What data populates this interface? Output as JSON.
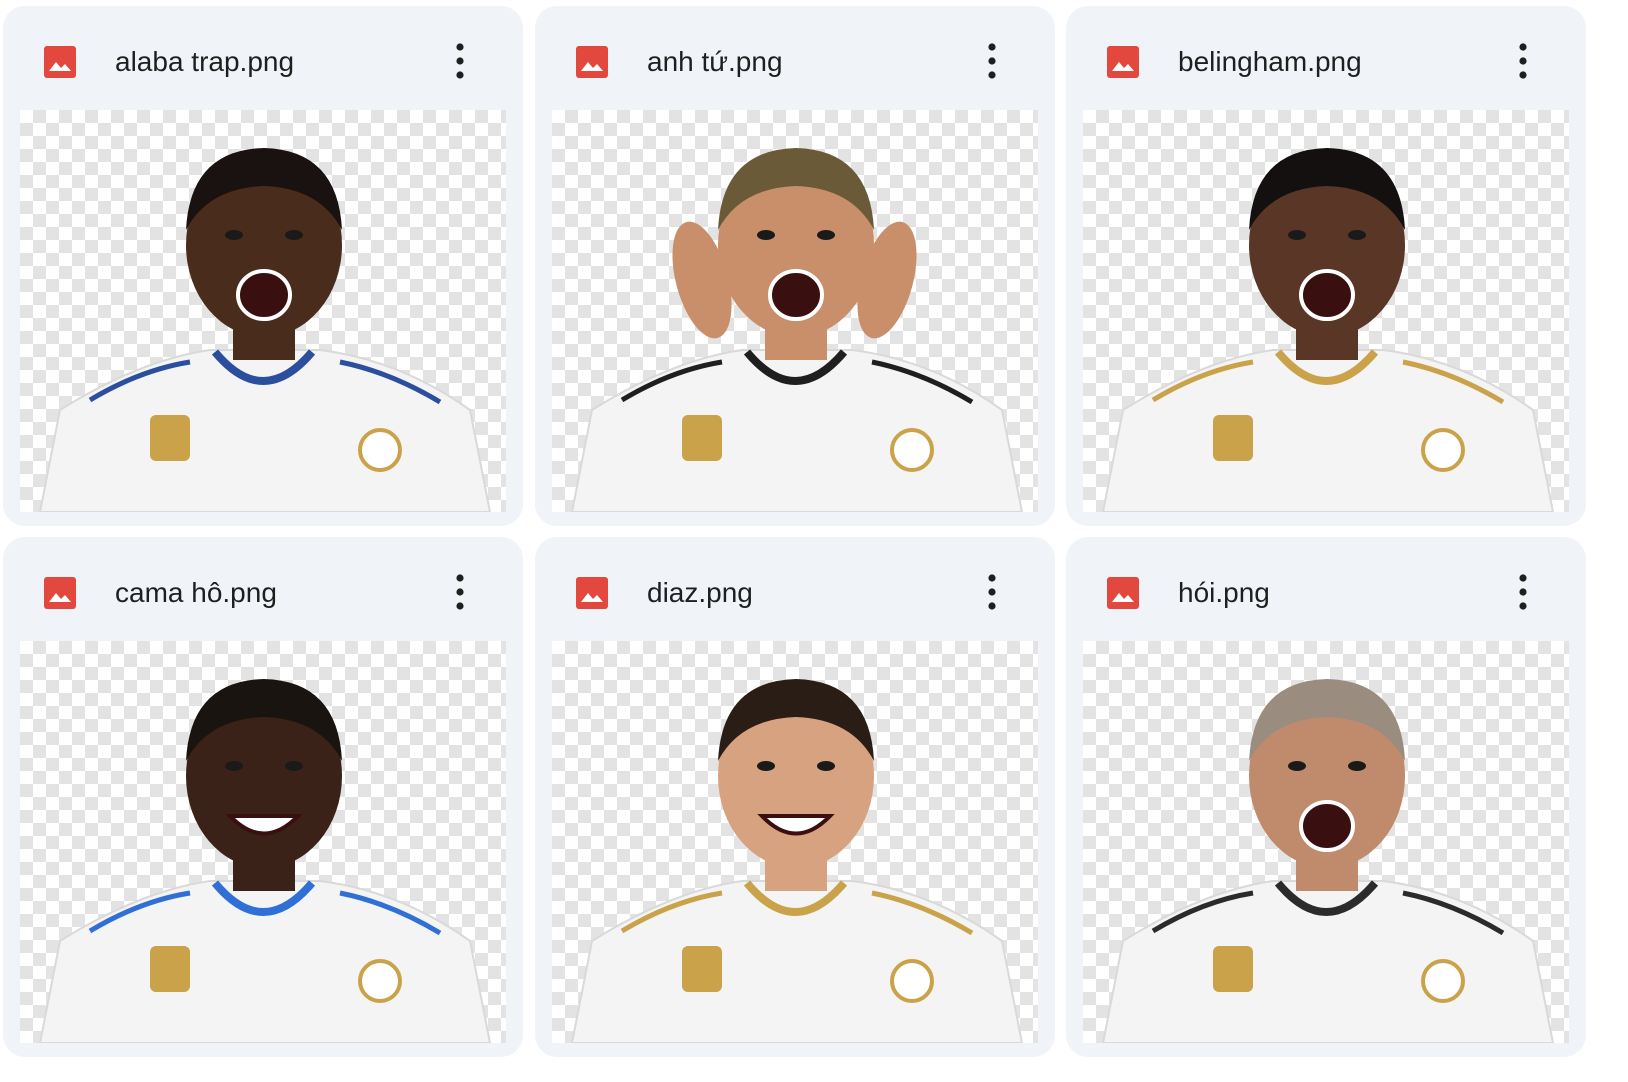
{
  "files": [
    {
      "name": "alaba trap.png",
      "icon": "image-file-icon",
      "thumb": "player-celebrating-image",
      "skin": "#4a2c1d",
      "hair": "#1a1210",
      "mouth": "open",
      "kit_trim": "#2b4f9e",
      "hands_up": false
    },
    {
      "name": "anh tứ.png",
      "icon": "image-file-icon",
      "thumb": "player-cupping-ears-image",
      "skin": "#c98e6a",
      "hair": "#6b5a38",
      "mouth": "open",
      "kit_trim": "#1f1f1f",
      "hands_up": true
    },
    {
      "name": "belingham.png",
      "icon": "image-file-icon",
      "thumb": "player-shouting-image",
      "skin": "#5a3626",
      "hair": "#151010",
      "mouth": "open",
      "kit_trim": "#c9a24a",
      "hands_up": false
    },
    {
      "name": "cama hô.png",
      "icon": "image-file-icon",
      "thumb": "player-laughing-image",
      "skin": "#3b2218",
      "hair": "#1a1410",
      "mouth": "smile",
      "kit_trim": "#2f6fd6",
      "hands_up": false
    },
    {
      "name": "diaz.png",
      "icon": "image-file-icon",
      "thumb": "player-smiling-image",
      "skin": "#d7a27f",
      "hair": "#2a1d16",
      "mouth": "smile",
      "kit_trim": "#c9a24a",
      "hands_up": false
    },
    {
      "name": "hói.png",
      "icon": "image-file-icon",
      "thumb": "player-roaring-image",
      "skin": "#c08a6c",
      "hair": "#9a8c7e",
      "mouth": "open",
      "kit_trim": "#2b2b2b",
      "hands_up": false
    }
  ],
  "colors": {
    "card_bg": "#f0f4f9",
    "icon_red": "#e2483d",
    "text": "#1f1f1f",
    "checker": "#e3e3e3",
    "kit": "#f4f4f4"
  },
  "menu_icon": "more-vert-icon"
}
